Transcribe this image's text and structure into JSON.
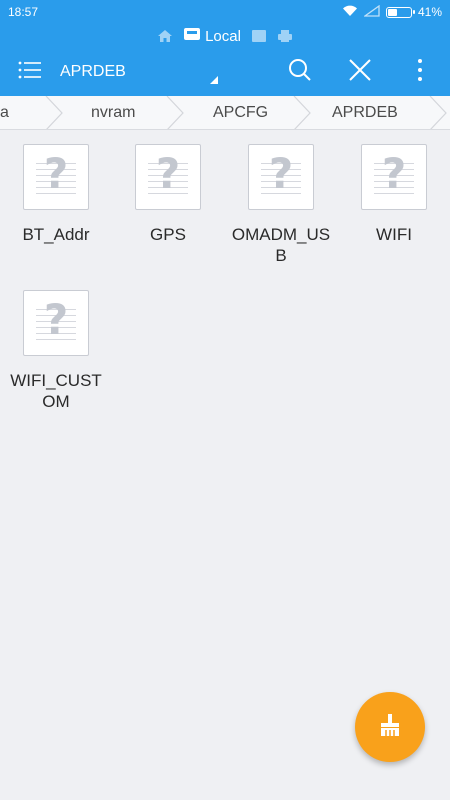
{
  "status_bar": {
    "time": "18:57",
    "battery_text": "41%",
    "battery_level": 0.41,
    "icons": [
      "wifi-icon",
      "signal-icon",
      "battery-icon"
    ]
  },
  "header": {
    "storage_tabs": [
      "home-icon",
      "sd-card-icon",
      "local",
      "image-icon",
      "printer-icon"
    ],
    "storage_label": "Local",
    "title": "APRDEB",
    "actions": [
      "search-icon",
      "close-icon",
      "more-vert-icon"
    ]
  },
  "breadcrumb": {
    "items": [
      "a",
      "nvram",
      "APCFG",
      "APRDEB"
    ]
  },
  "files": [
    {
      "name": "BT_Addr",
      "icon": "unknown-file-icon"
    },
    {
      "name": "GPS",
      "icon": "unknown-file-icon"
    },
    {
      "name": "OMADM_USB",
      "icon": "unknown-file-icon"
    },
    {
      "name": "WIFI",
      "icon": "unknown-file-icon"
    },
    {
      "name": "WIFI_CUSTOM",
      "icon": "unknown-file-icon"
    }
  ],
  "fab": {
    "icon": "broom-clean-icon"
  },
  "colors": {
    "primary": "#2a9ceb",
    "background": "#eff0f3",
    "fab": "#f9a11b"
  }
}
